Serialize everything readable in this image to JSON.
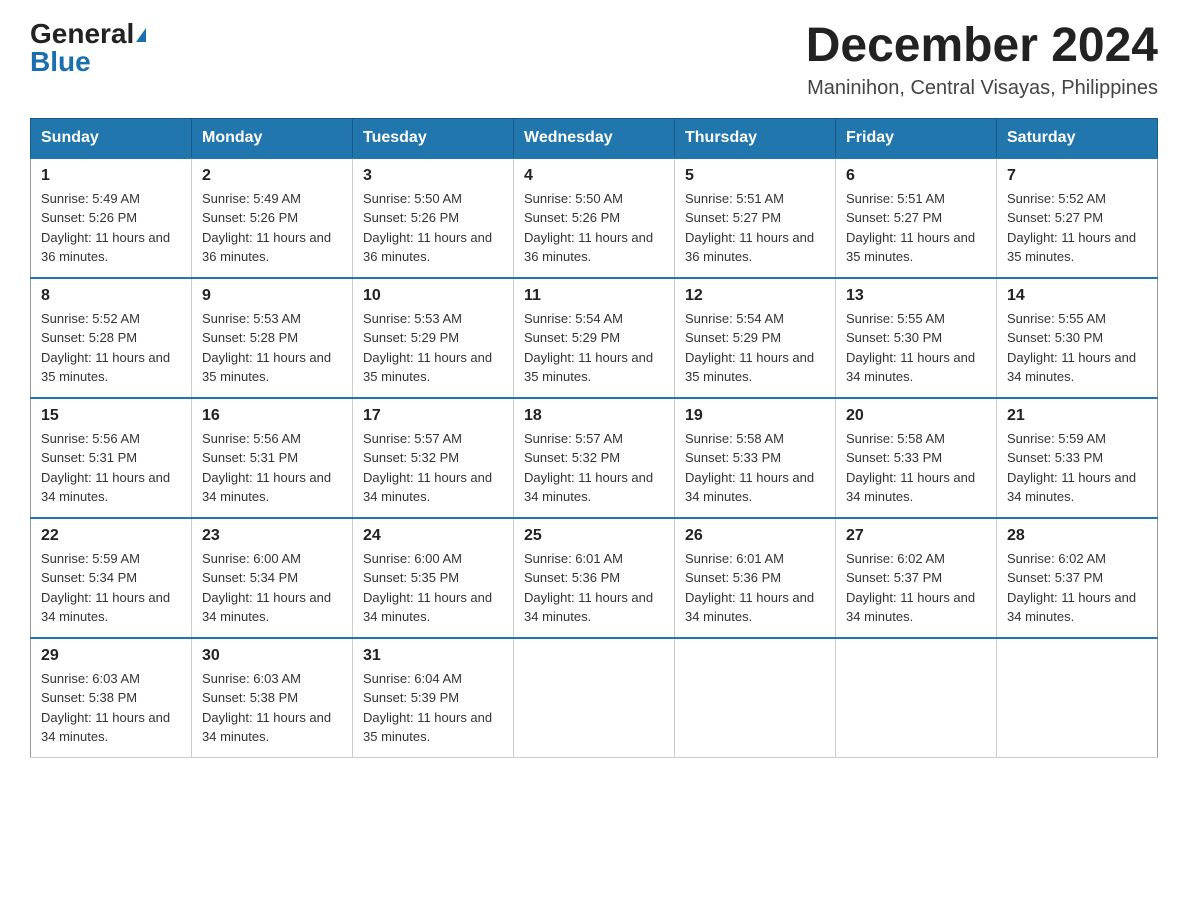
{
  "header": {
    "logo_general": "General",
    "logo_blue": "Blue",
    "month_year": "December 2024",
    "location": "Maninihon, Central Visayas, Philippines"
  },
  "calendar": {
    "days_of_week": [
      "Sunday",
      "Monday",
      "Tuesday",
      "Wednesday",
      "Thursday",
      "Friday",
      "Saturday"
    ],
    "weeks": [
      [
        {
          "day": "1",
          "sunrise": "5:49 AM",
          "sunset": "5:26 PM",
          "daylight": "11 hours and 36 minutes."
        },
        {
          "day": "2",
          "sunrise": "5:49 AM",
          "sunset": "5:26 PM",
          "daylight": "11 hours and 36 minutes."
        },
        {
          "day": "3",
          "sunrise": "5:50 AM",
          "sunset": "5:26 PM",
          "daylight": "11 hours and 36 minutes."
        },
        {
          "day": "4",
          "sunrise": "5:50 AM",
          "sunset": "5:26 PM",
          "daylight": "11 hours and 36 minutes."
        },
        {
          "day": "5",
          "sunrise": "5:51 AM",
          "sunset": "5:27 PM",
          "daylight": "11 hours and 36 minutes."
        },
        {
          "day": "6",
          "sunrise": "5:51 AM",
          "sunset": "5:27 PM",
          "daylight": "11 hours and 35 minutes."
        },
        {
          "day": "7",
          "sunrise": "5:52 AM",
          "sunset": "5:27 PM",
          "daylight": "11 hours and 35 minutes."
        }
      ],
      [
        {
          "day": "8",
          "sunrise": "5:52 AM",
          "sunset": "5:28 PM",
          "daylight": "11 hours and 35 minutes."
        },
        {
          "day": "9",
          "sunrise": "5:53 AM",
          "sunset": "5:28 PM",
          "daylight": "11 hours and 35 minutes."
        },
        {
          "day": "10",
          "sunrise": "5:53 AM",
          "sunset": "5:29 PM",
          "daylight": "11 hours and 35 minutes."
        },
        {
          "day": "11",
          "sunrise": "5:54 AM",
          "sunset": "5:29 PM",
          "daylight": "11 hours and 35 minutes."
        },
        {
          "day": "12",
          "sunrise": "5:54 AM",
          "sunset": "5:29 PM",
          "daylight": "11 hours and 35 minutes."
        },
        {
          "day": "13",
          "sunrise": "5:55 AM",
          "sunset": "5:30 PM",
          "daylight": "11 hours and 34 minutes."
        },
        {
          "day": "14",
          "sunrise": "5:55 AM",
          "sunset": "5:30 PM",
          "daylight": "11 hours and 34 minutes."
        }
      ],
      [
        {
          "day": "15",
          "sunrise": "5:56 AM",
          "sunset": "5:31 PM",
          "daylight": "11 hours and 34 minutes."
        },
        {
          "day": "16",
          "sunrise": "5:56 AM",
          "sunset": "5:31 PM",
          "daylight": "11 hours and 34 minutes."
        },
        {
          "day": "17",
          "sunrise": "5:57 AM",
          "sunset": "5:32 PM",
          "daylight": "11 hours and 34 minutes."
        },
        {
          "day": "18",
          "sunrise": "5:57 AM",
          "sunset": "5:32 PM",
          "daylight": "11 hours and 34 minutes."
        },
        {
          "day": "19",
          "sunrise": "5:58 AM",
          "sunset": "5:33 PM",
          "daylight": "11 hours and 34 minutes."
        },
        {
          "day": "20",
          "sunrise": "5:58 AM",
          "sunset": "5:33 PM",
          "daylight": "11 hours and 34 minutes."
        },
        {
          "day": "21",
          "sunrise": "5:59 AM",
          "sunset": "5:33 PM",
          "daylight": "11 hours and 34 minutes."
        }
      ],
      [
        {
          "day": "22",
          "sunrise": "5:59 AM",
          "sunset": "5:34 PM",
          "daylight": "11 hours and 34 minutes."
        },
        {
          "day": "23",
          "sunrise": "6:00 AM",
          "sunset": "5:34 PM",
          "daylight": "11 hours and 34 minutes."
        },
        {
          "day": "24",
          "sunrise": "6:00 AM",
          "sunset": "5:35 PM",
          "daylight": "11 hours and 34 minutes."
        },
        {
          "day": "25",
          "sunrise": "6:01 AM",
          "sunset": "5:36 PM",
          "daylight": "11 hours and 34 minutes."
        },
        {
          "day": "26",
          "sunrise": "6:01 AM",
          "sunset": "5:36 PM",
          "daylight": "11 hours and 34 minutes."
        },
        {
          "day": "27",
          "sunrise": "6:02 AM",
          "sunset": "5:37 PM",
          "daylight": "11 hours and 34 minutes."
        },
        {
          "day": "28",
          "sunrise": "6:02 AM",
          "sunset": "5:37 PM",
          "daylight": "11 hours and 34 minutes."
        }
      ],
      [
        {
          "day": "29",
          "sunrise": "6:03 AM",
          "sunset": "5:38 PM",
          "daylight": "11 hours and 34 minutes."
        },
        {
          "day": "30",
          "sunrise": "6:03 AM",
          "sunset": "5:38 PM",
          "daylight": "11 hours and 34 minutes."
        },
        {
          "day": "31",
          "sunrise": "6:04 AM",
          "sunset": "5:39 PM",
          "daylight": "11 hours and 35 minutes."
        },
        null,
        null,
        null,
        null
      ]
    ]
  },
  "labels": {
    "sunrise_prefix": "Sunrise: ",
    "sunset_prefix": "Sunset: ",
    "daylight_prefix": "Daylight: "
  }
}
